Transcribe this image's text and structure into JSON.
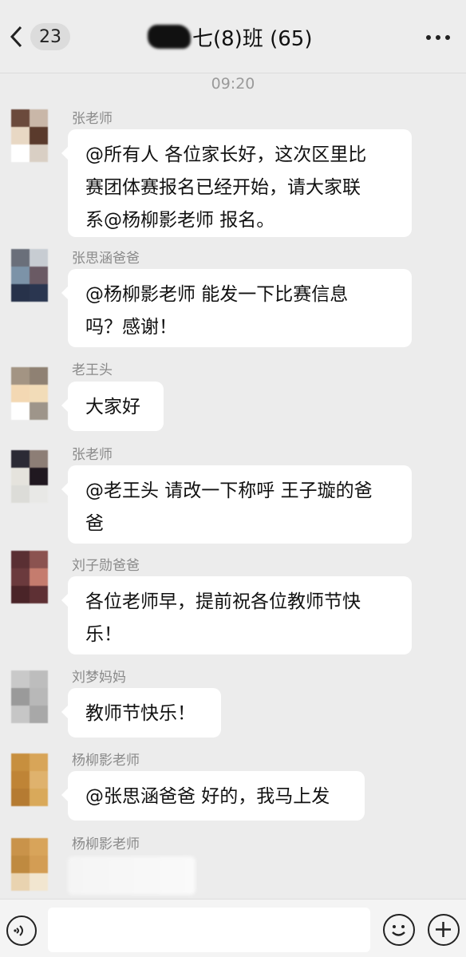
{
  "header": {
    "unread_count": "23",
    "title": "七(8)班 (65)"
  },
  "time_divider": "09:20",
  "messages": [
    {
      "sender": "张老师",
      "text": "@所有人 各位家长好，这次区里比\n赛团体赛报名已经开始，请大家联\n系@杨柳影老师 报名。"
    },
    {
      "sender": "张思涵爸爸",
      "text": "@杨柳影老师 能发一下比赛信息\n吗？感谢！"
    },
    {
      "sender": "老王头",
      "text": "大家好"
    },
    {
      "sender": "张老师",
      "text": "@老王头 请改一下称呼 王子璇的爸\n爸"
    },
    {
      "sender": "刘子勋爸爸",
      "text": "各位老师早，提前祝各位教师节快\n乐！"
    },
    {
      "sender": "刘梦妈妈",
      "text": "教师节快乐！"
    },
    {
      "sender": "杨柳影老师",
      "text": "@张思涵爸爸 好的，我马上发"
    },
    {
      "sender": "杨柳影老师",
      "text": ""
    }
  ],
  "avatars": [
    [
      "#6b4a3c",
      "#c9b7a8",
      "#e8d8c4",
      "#5a3a2c",
      "#ffffff",
      "#d9cfc4"
    ],
    [
      "#6a6f7a",
      "#c7ccd2",
      "#7c93a8",
      "#6a5a64",
      "#27324a",
      "#2a3650"
    ],
    [
      "#a39483",
      "#8f8173",
      "#f3d8b3",
      "#f2dcb8",
      "#ffffff",
      "#9e958a"
    ],
    [
      "#2b2a35",
      "#8d7e76",
      "#e5e3dd",
      "#201820",
      "#dcdcd8",
      "#e8e8e6"
    ],
    [
      "#5a2f33",
      "#8b5350",
      "#6b3a3d",
      "#c57c6e",
      "#4a2428",
      "#5e3034"
    ],
    [
      "#c9c9c9",
      "#bdbdbd",
      "#9a9a9a",
      "#b8b8b8",
      "#c6c6c6",
      "#a8a8a8"
    ],
    [
      "#c78f3e",
      "#d8a558",
      "#bf8436",
      "#dfb26d",
      "#b57b32",
      "#d9a95a"
    ],
    [
      "#c9934a",
      "#d8a45a",
      "#bf8a40",
      "#d39d54",
      "#e9d3b0",
      "#f2e6d0"
    ]
  ],
  "input": {
    "placeholder": ""
  },
  "icons": [
    "back-chevron-icon",
    "more-icon",
    "voice-icon",
    "emoji-icon",
    "plus-icon"
  ]
}
